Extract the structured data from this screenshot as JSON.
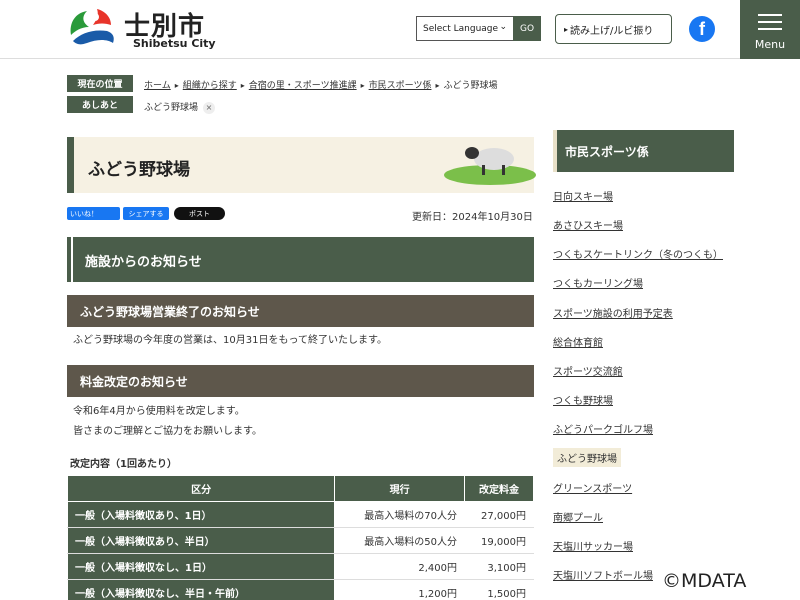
{
  "header": {
    "site_name": "士別市",
    "site_sub": "Shibetsu City",
    "language_select": "Select Language",
    "go_label": "GO",
    "read_aloud_label": "読み上げ/ルビ振り",
    "menu_label": "Menu",
    "facebook_glyph": "f"
  },
  "breadcrumb": {
    "location_tag": "現在の位置",
    "history_tag": "あしあと",
    "items": [
      "ホーム",
      "組織から探す",
      "合宿の里・スポーツ推進課",
      "市民スポーツ係",
      "ふどう野球場"
    ],
    "history_items": [
      "ふどう野球場"
    ],
    "remove_glyph": "×",
    "sep_glyph": "▸"
  },
  "page": {
    "title": "ふどう野球場",
    "updated": "更新日：2024年10月30日"
  },
  "social": {
    "like": "いいね！",
    "share": "シェアする",
    "post": "ポスト"
  },
  "content": {
    "h2_facility_notice": "施設からのお知らせ",
    "h3_closing": "ふどう野球場営業終了のお知らせ",
    "closing_text": "ふどう野球場の今年度の営業は、10月31日をもって終了いたします。",
    "h3_fee": "料金改定のお知らせ",
    "fee_line1": "令和6年4月から使用料を改定します。",
    "fee_line2": "皆さまのご理解とご協力をお願いします。",
    "fee_subhead": "改定内容（1回あたり）"
  },
  "fee_table": {
    "headers": [
      "区分",
      "現行",
      "改定料金"
    ],
    "rows": [
      {
        "label": "一般（入場料徴収あり、1日）",
        "current": "最高入場料の70人分",
        "revised": "27,000円"
      },
      {
        "label": "一般（入場料徴収あり、半日）",
        "current": "最高入場料の50人分",
        "revised": "19,000円"
      },
      {
        "label": "一般（入場料徴収なし、1日）",
        "current": "2,400円",
        "revised": "3,100円"
      },
      {
        "label": "一般（入場料徴収なし、半日・午前）",
        "current": "1,200円",
        "revised": "1,500円"
      }
    ]
  },
  "sidebar": {
    "heading": "市民スポーツ係",
    "items": [
      "日向スキー場",
      "あさひスキー場",
      "つくもスケートリンク（冬のつくも）",
      "つくもカーリング場",
      "スポーツ施設の利用予定表",
      "総合体育館",
      "スポーツ交流館",
      "つくも野球場",
      "ふどうパークゴルフ場",
      "ふどう野球場",
      "グリーンスポーツ",
      "南郷プール",
      "天塩川サッカー場",
      "天塩川ソフトボール場"
    ],
    "active_index": 9
  },
  "watermark": "©MDATA",
  "colors": {
    "primary": "#4a5d4a",
    "h3": "#5e574b",
    "title_bg": "#f6f1e3",
    "facebook": "#1877f2"
  }
}
